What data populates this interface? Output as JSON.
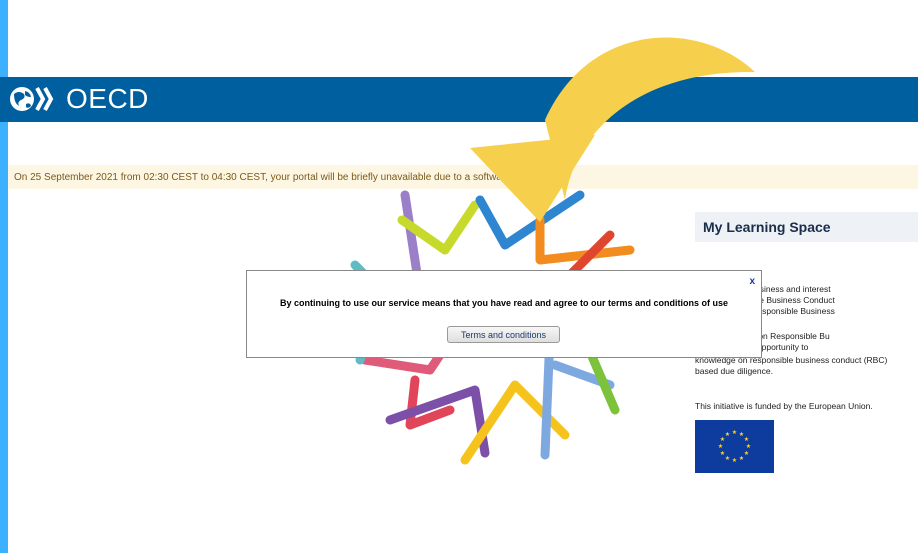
{
  "header": {
    "logo_text": "OECD"
  },
  "banner": {
    "text": "On 25 September 2021 from 02:30 CEST to 04:30 CEST, your portal will be briefly unavailable due to a software u"
  },
  "panel": {
    "title": "My Learning Space",
    "lines": [
      "ity-building for business and interest",
      "re for Responsible Business Conduct",
      "g Academy on Responsible Business",
      "arning Academy on Responsible Bu",
      "rs with a unique opportunity to",
      "knowledge on responsible business conduct (RBC)",
      "based due diligence."
    ],
    "funding": "This initiative is funded by the European Union."
  },
  "modal": {
    "close": "x",
    "message": "By continuing to use our service means that you have read and agree to our terms and conditions of use",
    "button": "Terms and conditions"
  },
  "colors": {
    "header": "#005f9e",
    "accent": "#3bb1ff",
    "arrow": "#f6d04d"
  }
}
